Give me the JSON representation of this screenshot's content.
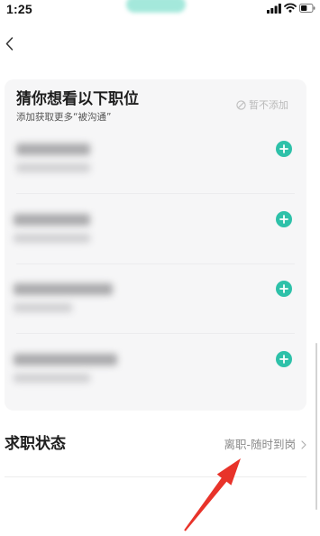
{
  "status_bar": {
    "time": "1:25",
    "battery_level": 0.55,
    "icons": [
      "signal-icon",
      "wifi-icon",
      "battery-icon"
    ]
  },
  "header": {
    "back_icon": "chevron-left-icon"
  },
  "recommend_card": {
    "title": "猜你想看以下职位",
    "subtitle": "添加获取更多“被沟通”",
    "dismiss_icon": "ban-icon",
    "dismiss_label": "暂不添加",
    "add_icon": "plus-circle-icon"
  },
  "job_status": {
    "label": "求职状态",
    "value": "离职-随时到岗",
    "chevron_icon": "chevron-right-icon"
  },
  "colors": {
    "accent": "#2ec1a9",
    "annotation_arrow": "#e8332a",
    "card_background": "#f6f6f7"
  }
}
